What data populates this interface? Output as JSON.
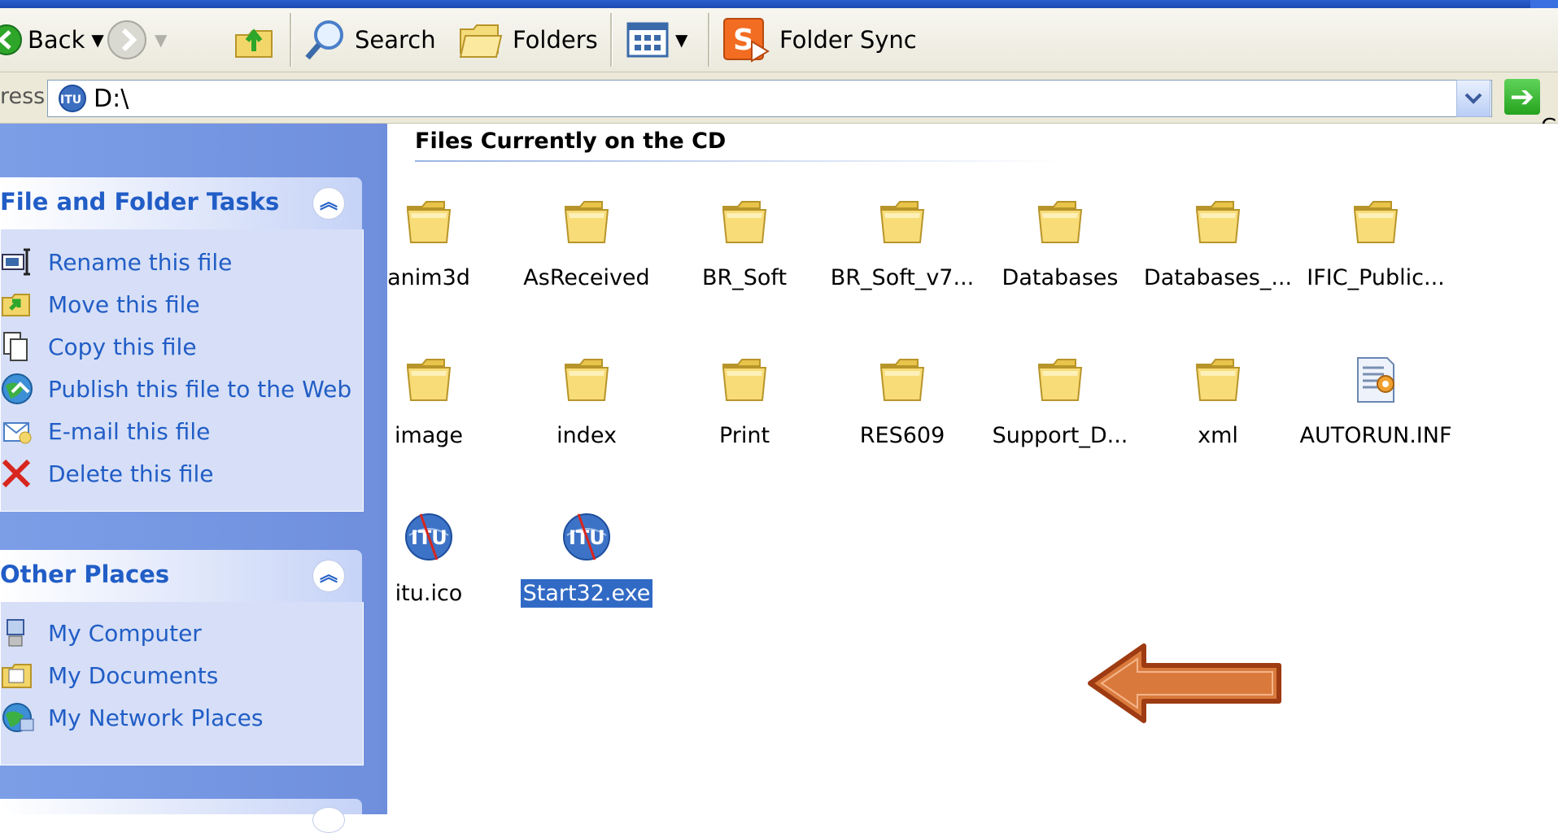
{
  "toolbar": {
    "back_label": "Back",
    "search_label": "Search",
    "folders_label": "Folders",
    "foldersync_label": "Folder Sync"
  },
  "address": {
    "label": "ress",
    "value": "D:\\",
    "go_label": "Go"
  },
  "taskpane": {
    "file_tasks": {
      "title": "File and Folder Tasks",
      "items": [
        {
          "label": "Rename this file",
          "icon": "rename-icon"
        },
        {
          "label": "Move this file",
          "icon": "move-icon"
        },
        {
          "label": "Copy this file",
          "icon": "copy-icon"
        },
        {
          "label": "Publish this file to the Web",
          "icon": "publish-web-icon"
        },
        {
          "label": "E-mail this file",
          "icon": "email-icon"
        },
        {
          "label": "Delete this file",
          "icon": "delete-icon"
        }
      ]
    },
    "other_places": {
      "title": "Other Places",
      "items": [
        {
          "label": "My Computer",
          "icon": "my-computer-icon"
        },
        {
          "label": "My Documents",
          "icon": "my-documents-icon"
        },
        {
          "label": "My Network Places",
          "icon": "network-places-icon"
        }
      ]
    }
  },
  "content": {
    "group_title": "Files Currently on the CD",
    "items": [
      {
        "name": "anim3d",
        "type": "folder"
      },
      {
        "name": "AsReceived",
        "type": "folder"
      },
      {
        "name": "BR_Soft",
        "type": "folder"
      },
      {
        "name": "BR_Soft_v7...",
        "type": "folder"
      },
      {
        "name": "Databases",
        "type": "folder"
      },
      {
        "name": "Databases_...",
        "type": "folder"
      },
      {
        "name": "IFIC_Public...",
        "type": "folder"
      },
      {
        "name": "image",
        "type": "folder"
      },
      {
        "name": "index",
        "type": "folder"
      },
      {
        "name": "Print",
        "type": "folder"
      },
      {
        "name": "RES609",
        "type": "folder"
      },
      {
        "name": "Support_D...",
        "type": "folder"
      },
      {
        "name": "xml",
        "type": "folder"
      },
      {
        "name": "AUTORUN.INF",
        "type": "settings-file"
      },
      {
        "name": "itu.ico",
        "type": "itu-icon"
      },
      {
        "name": "Start32.exe",
        "type": "itu-exe",
        "selected": true
      }
    ]
  },
  "colors": {
    "taskpane_bg": "#7c9ee7",
    "link": "#215dc6",
    "selection": "#316ac5",
    "arrow_fill": "#d97a3c",
    "arrow_outline": "#9e3b12"
  }
}
